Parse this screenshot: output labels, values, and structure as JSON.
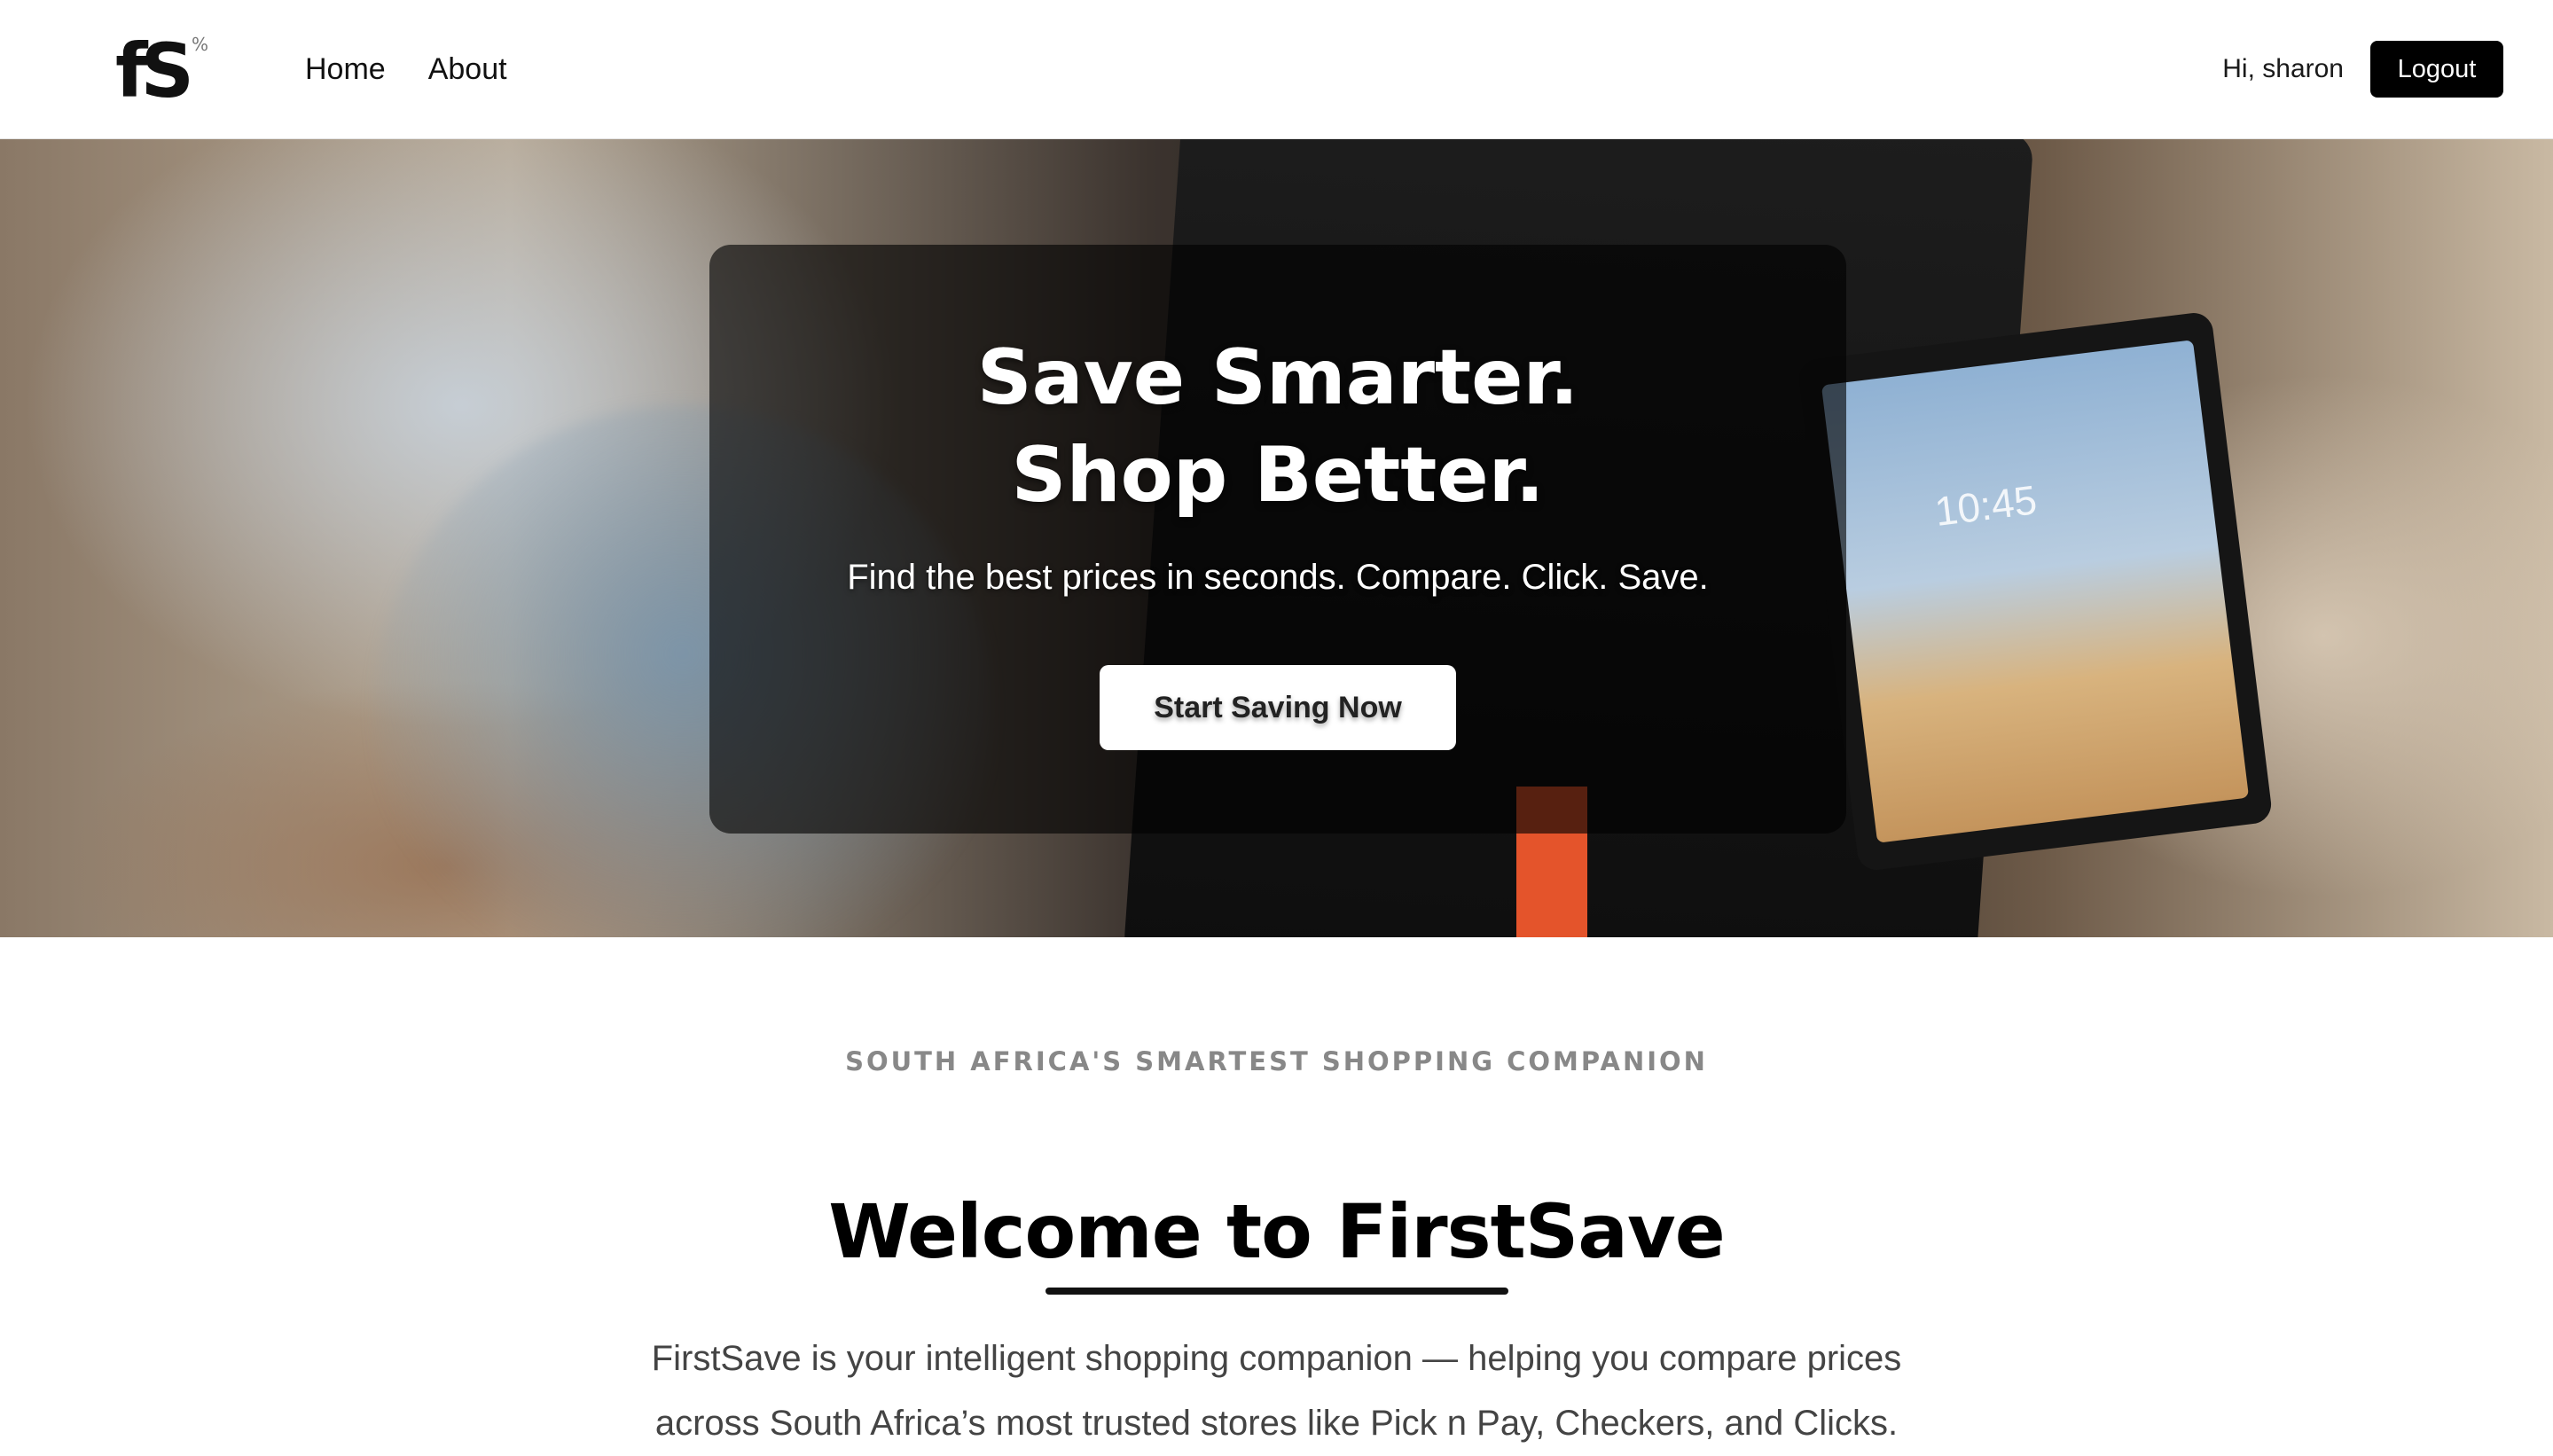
{
  "header": {
    "logo_text": "fS",
    "logo_mark": "%",
    "nav": {
      "home": "Home",
      "about": "About"
    },
    "greeting": "Hi, sharon",
    "logout_label": "Logout"
  },
  "hero": {
    "title": "Save Smarter. Shop Better.",
    "subtitle": "Find the best prices in seconds. Compare. Click. Save.",
    "cta_label": "Start Saving Now",
    "tablet_clock": "10:45"
  },
  "intro": {
    "eyebrow": "SOUTH AFRICA'S SMARTEST SHOPPING COMPANION",
    "title": "Welcome to FirstSave",
    "description": "FirstSave is your intelligent shopping companion — helping you compare prices across South Africa’s most trusted stores like Pick n Pay, Checkers, and Clicks."
  },
  "colors": {
    "primary": "#000000",
    "background": "#ffffff",
    "overlay": "#000000",
    "eyebrow": "#888888",
    "body_text": "#444444"
  }
}
